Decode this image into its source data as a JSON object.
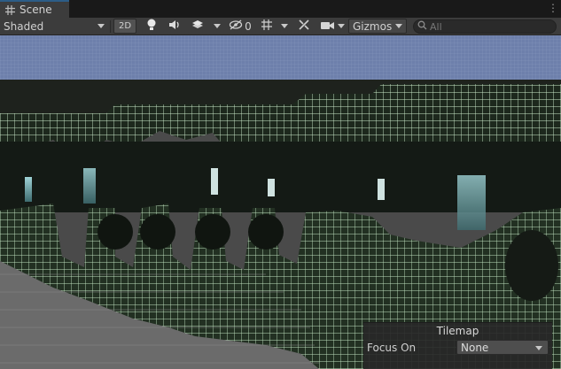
{
  "tab": {
    "title": "Scene",
    "icon": "hash-icon"
  },
  "toolbar": {
    "shading_mode": "Shaded",
    "mode_2d": "2D",
    "hidden_count": "0",
    "gizmos": "Gizmos",
    "search_placeholder": "All",
    "icons": [
      "lightbulb-icon",
      "speaker-icon",
      "effects-icon",
      "hidden-objects-icon",
      "grid-snap-icon",
      "tools-icon",
      "camera-icon",
      "search-icon"
    ]
  },
  "tilemap": {
    "title": "Tilemap",
    "focus_label": "Focus On",
    "focus_value": "None"
  },
  "colors": {
    "sky": "#6d7fab",
    "grid": "#cdebcc",
    "tile_dark": "#1f2a1f",
    "accent": "#2c5d87"
  }
}
